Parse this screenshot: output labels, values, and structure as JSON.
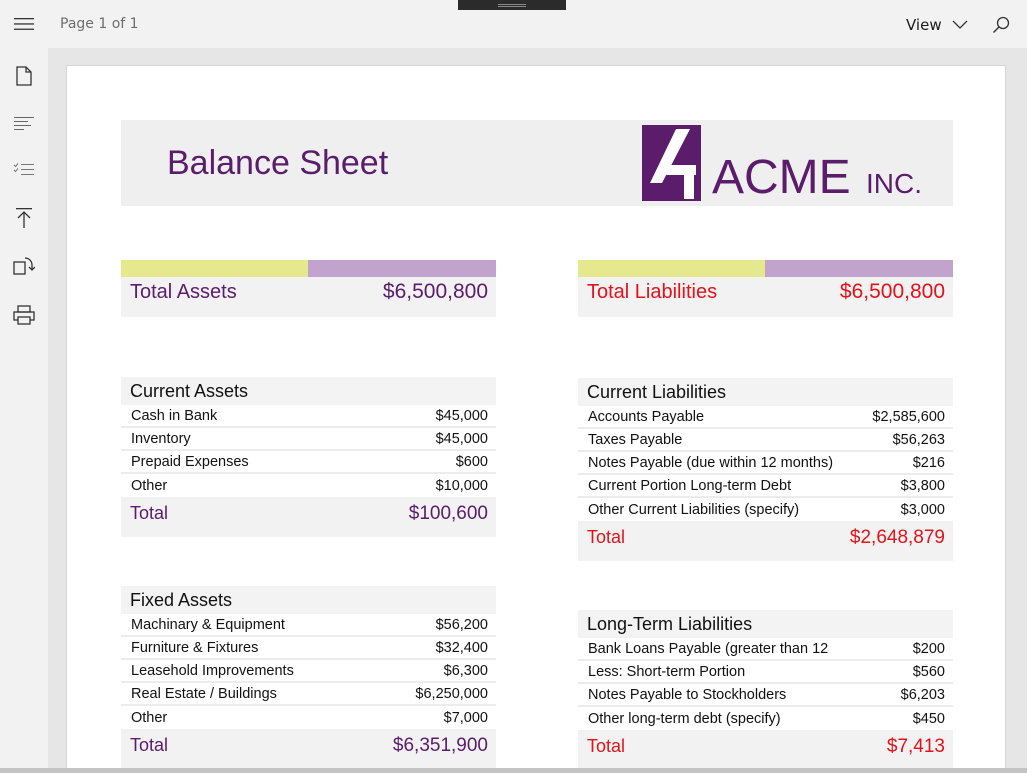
{
  "toolbar": {
    "page_indicator": "Page 1 of 1",
    "view_label": "View"
  },
  "rail": {
    "items": [
      {
        "icon": "document-icon"
      },
      {
        "icon": "table-of-contents-icon"
      },
      {
        "icon": "list-icon"
      },
      {
        "icon": "go-to-top-icon"
      },
      {
        "icon": "rotate-icon"
      },
      {
        "icon": "print-icon"
      }
    ]
  },
  "colors": {
    "brand_purple": "#5a1c6b",
    "accent_red": "#e2121b",
    "bar_yellow": "#e6e88e",
    "bar_purple": "#c1a3cd"
  },
  "document": {
    "title": "Balance Sheet",
    "logo_text": "ACME",
    "logo_suffix": "INC.",
    "total_assets": {
      "label": "Total Assets",
      "value": "$6,500,800"
    },
    "total_liabilities": {
      "label": "Total Liabilities",
      "value": "$6,500,800"
    },
    "current_assets": {
      "title": "Current Assets",
      "rows": [
        {
          "label": "Cash in Bank",
          "value": "$45,000"
        },
        {
          "label": "Inventory",
          "value": "$45,000"
        },
        {
          "label": "Prepaid Expenses",
          "value": "$600"
        },
        {
          "label": "Other",
          "value": "$10,000"
        }
      ],
      "total_label": "Total",
      "total_value": "$100,600"
    },
    "fixed_assets": {
      "title": "Fixed Assets",
      "rows": [
        {
          "label": "Machinary & Equipment",
          "value": "$56,200"
        },
        {
          "label": "Furniture & Fixtures",
          "value": "$32,400"
        },
        {
          "label": "Leasehold Improvements",
          "value": "$6,300"
        },
        {
          "label": "Real Estate / Buildings",
          "value": "$6,250,000"
        },
        {
          "label": "Other",
          "value": "$7,000"
        }
      ],
      "total_label": "Total",
      "total_value": "$6,351,900"
    },
    "current_liabilities": {
      "title": "Current Liabilities",
      "rows": [
        {
          "label": "Accounts Payable",
          "value": "$2,585,600"
        },
        {
          "label": "Taxes Payable",
          "value": "$56,263"
        },
        {
          "label": "Notes Payable (due within 12 months)",
          "value": "$216"
        },
        {
          "label": "Current Portion Long-term Debt",
          "value": "$3,800"
        },
        {
          "label": "Other Current Liabilities (specify)",
          "value": "$3,000"
        }
      ],
      "total_label": "Total",
      "total_value": "$2,648,879"
    },
    "long_term_liabilities": {
      "title": "Long-Term Liabilities",
      "rows": [
        {
          "label": "Bank Loans Payable (greater than 12",
          "value": "$200"
        },
        {
          "label": "Less: Short-term Portion",
          "value": "$560"
        },
        {
          "label": "Notes Payable to Stockholders",
          "value": "$6,203"
        },
        {
          "label": "Other long-term debt (specify)",
          "value": "$450"
        }
      ],
      "total_label": "Total",
      "total_value": "$7,413"
    }
  }
}
